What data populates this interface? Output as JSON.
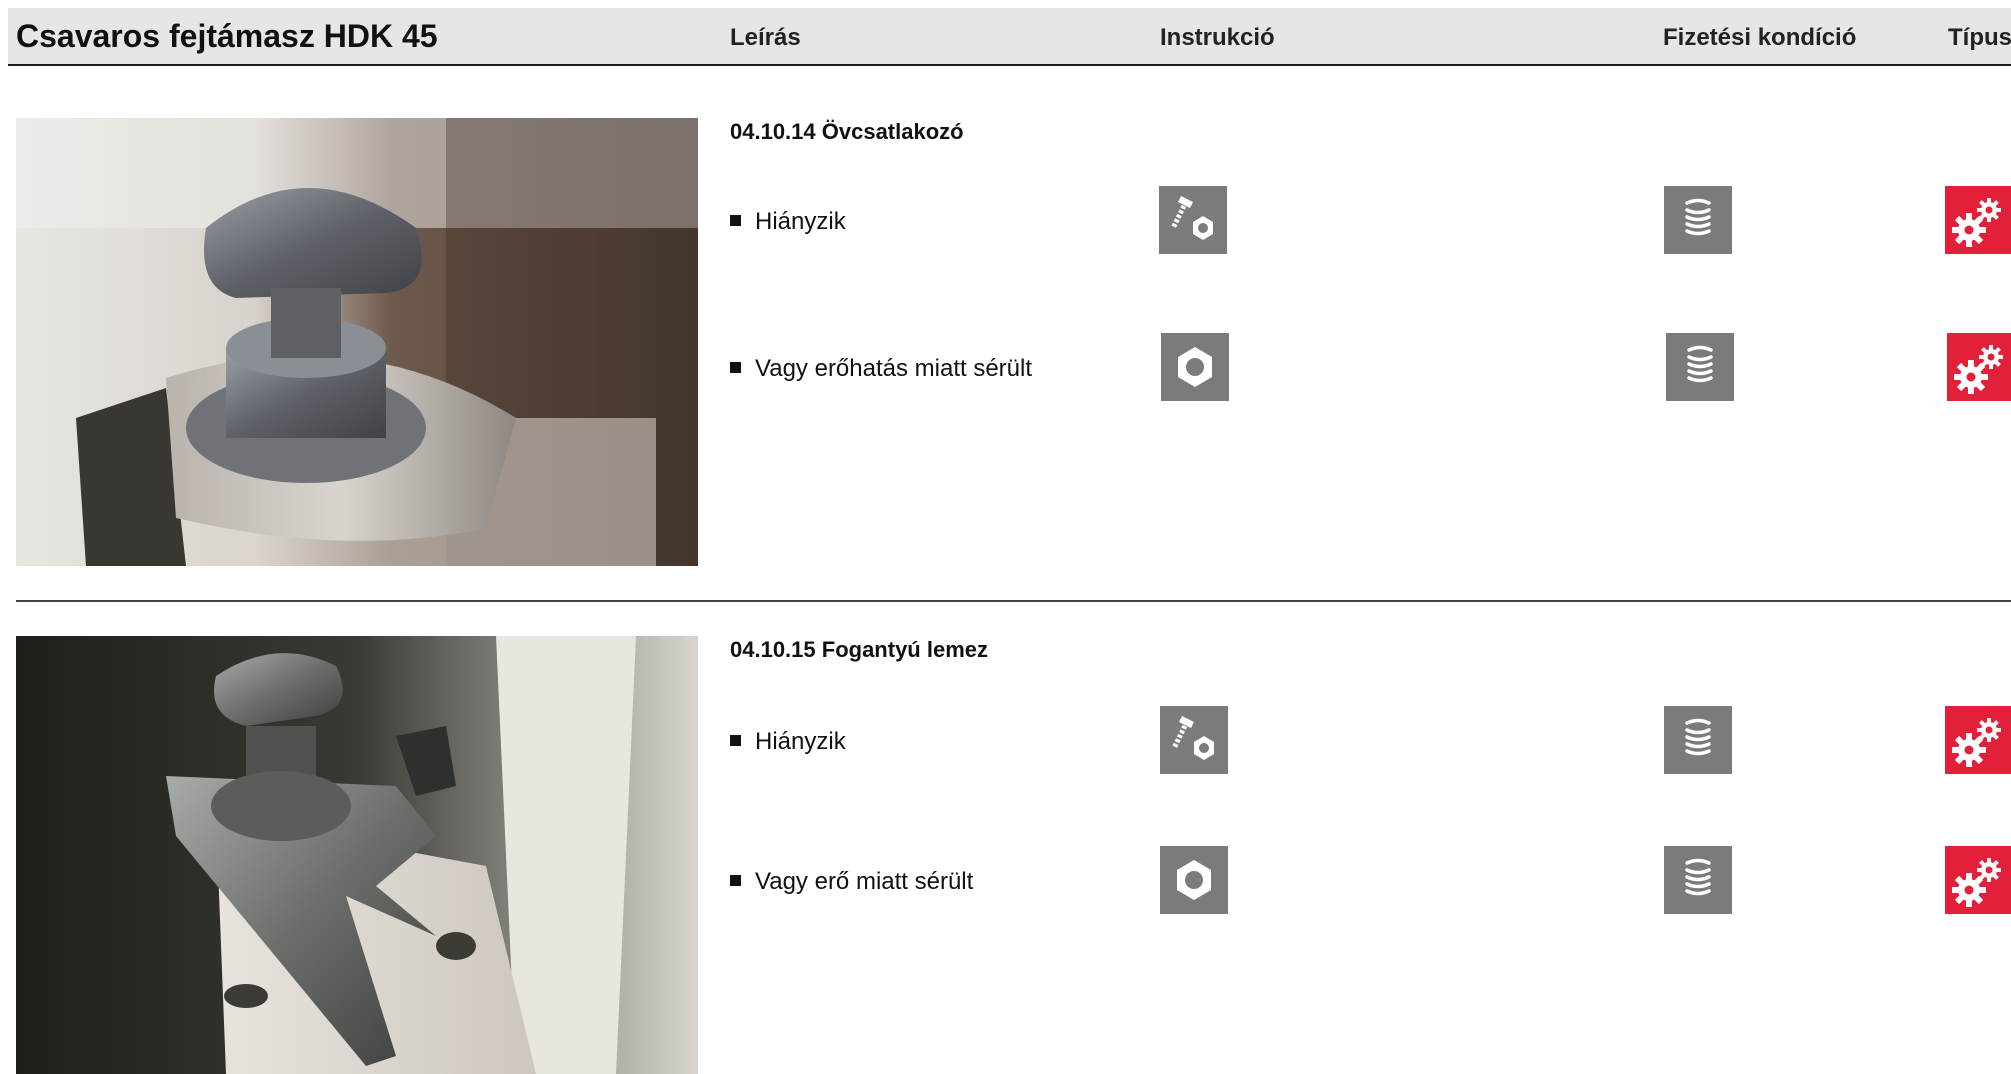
{
  "header": {
    "title": "Csavaros fejtámasz HDK 45",
    "columns": {
      "description": "Leírás",
      "instruction": "Instrukció",
      "payment": "Fizetési kondíció",
      "type": "Típus"
    }
  },
  "sections": [
    {
      "title": "04.10.14 Övcsatlakozó",
      "rows": [
        {
          "text": "Hiányzik",
          "instruction_icon": "bolt-nut-icon",
          "payment_icon": "coin-stack-icon",
          "type_icon": "gears-icon"
        },
        {
          "text": "Vagy erőhatás miatt sérült",
          "instruction_icon": "hex-nut-icon",
          "payment_icon": "coin-stack-icon",
          "type_icon": "gears-icon"
        }
      ]
    },
    {
      "title": "04.10.15 Fogantyú lemez",
      "rows": [
        {
          "text": "Hiányzik",
          "instruction_icon": "bolt-nut-icon",
          "payment_icon": "coin-stack-icon",
          "type_icon": "gears-icon"
        },
        {
          "text": "Vagy erő miatt sérült",
          "instruction_icon": "hex-nut-icon",
          "payment_icon": "coin-stack-icon",
          "type_icon": "gears-icon"
        }
      ]
    }
  ],
  "colors": {
    "header_bg": "#e6e6e6",
    "icon_grey": "#7b7b7b",
    "icon_red": "#e3203a"
  }
}
